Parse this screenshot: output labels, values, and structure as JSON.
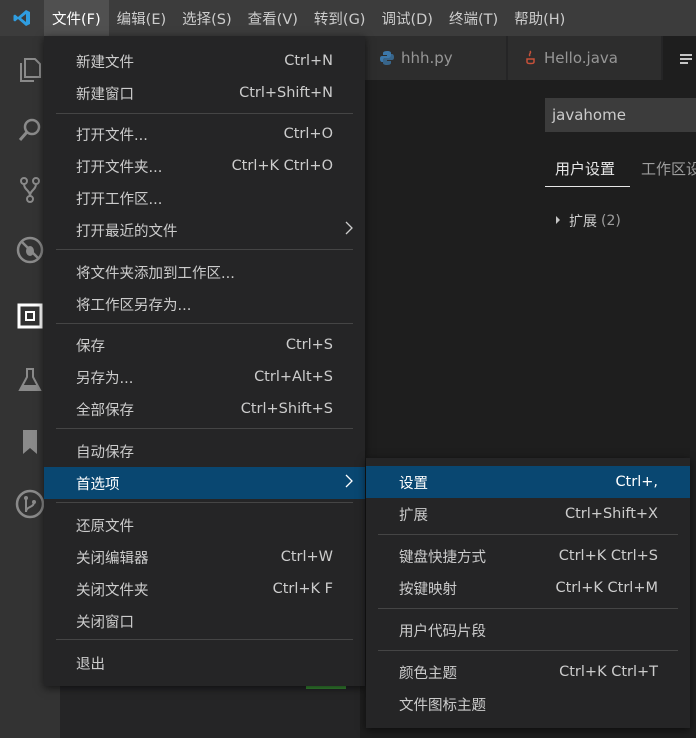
{
  "menubar": {
    "app_icon": "vscode-logo-icon",
    "items": [
      "文件(F)",
      "编辑(E)",
      "选择(S)",
      "查看(V)",
      "转到(G)",
      "调试(D)",
      "终端(T)",
      "帮助(H)"
    ],
    "active_index": 0
  },
  "activitybar": {
    "icons": [
      "files-icon",
      "search-icon",
      "source-control-icon",
      "debug-icon",
      "extensions-icon",
      "flask-icon",
      "bookmark-icon",
      "git-graph-icon"
    ]
  },
  "tabs": {
    "items": [
      {
        "label": "hhh.py",
        "icon": "python-icon"
      },
      {
        "label": "Hello.java",
        "icon": "java-icon"
      }
    ],
    "active_icon": "settings-file-icon"
  },
  "settings": {
    "search_value": "javahome",
    "tabs": [
      "用户设置",
      "工作区设"
    ],
    "tree": {
      "label": "扩展",
      "count": "(2)"
    }
  },
  "file_menu": {
    "groups": [
      [
        {
          "label": "新建文件",
          "key": "Ctrl+N"
        },
        {
          "label": "新建窗口",
          "key": "Ctrl+Shift+N"
        }
      ],
      [
        {
          "label": "打开文件...",
          "key": "Ctrl+O"
        },
        {
          "label": "打开文件夹...",
          "key": "Ctrl+K Ctrl+O"
        },
        {
          "label": "打开工作区...",
          "key": ""
        },
        {
          "label": "打开最近的文件",
          "key": "",
          "submenu": true
        }
      ],
      [
        {
          "label": "将文件夹添加到工作区...",
          "key": ""
        },
        {
          "label": "将工作区另存为...",
          "key": ""
        }
      ],
      [
        {
          "label": "保存",
          "key": "Ctrl+S"
        },
        {
          "label": "另存为...",
          "key": "Ctrl+Alt+S"
        },
        {
          "label": "全部保存",
          "key": "Ctrl+Shift+S"
        }
      ],
      [
        {
          "label": "自动保存",
          "key": ""
        },
        {
          "label": "首选项",
          "key": "",
          "submenu": true,
          "highlighted": true
        }
      ],
      [
        {
          "label": "还原文件",
          "key": ""
        },
        {
          "label": "关闭编辑器",
          "key": "Ctrl+W"
        },
        {
          "label": "关闭文件夹",
          "key": "Ctrl+K F"
        },
        {
          "label": "关闭窗口",
          "key": ""
        }
      ],
      [
        {
          "label": "退出",
          "key": ""
        }
      ]
    ]
  },
  "preferences_menu": {
    "groups": [
      [
        {
          "label": "设置",
          "key": "Ctrl+,",
          "highlighted": true
        },
        {
          "label": "扩展",
          "key": "Ctrl+Shift+X"
        }
      ],
      [
        {
          "label": "键盘快捷方式",
          "key": "Ctrl+K Ctrl+S"
        },
        {
          "label": "按键映射",
          "key": "Ctrl+K Ctrl+M"
        }
      ],
      [
        {
          "label": "用户代码片段",
          "key": ""
        }
      ],
      [
        {
          "label": "颜色主题",
          "key": "Ctrl+K Ctrl+T"
        },
        {
          "label": "文件图标主题",
          "key": ""
        }
      ]
    ]
  },
  "colors": {
    "menubar_bg": "#3c3c3c",
    "menu_bg": "#252526",
    "highlight": "#094771",
    "accent_blue": "#007acc"
  }
}
